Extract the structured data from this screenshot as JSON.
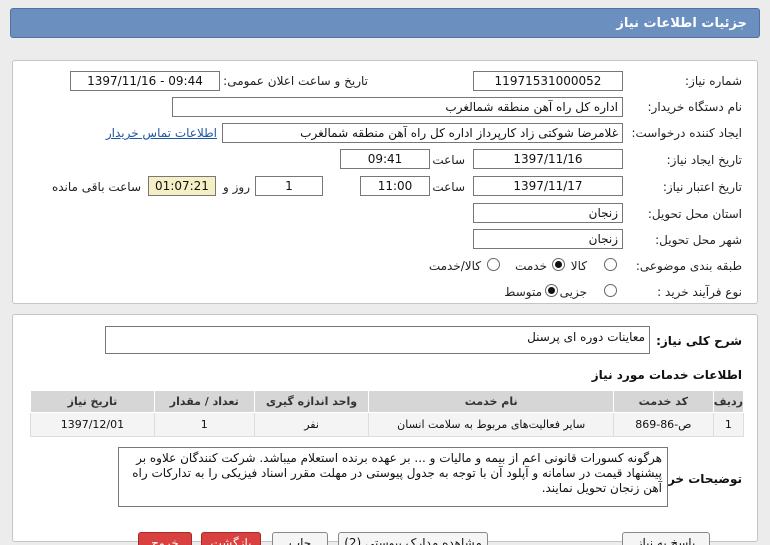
{
  "title": "جزئیات اطلاعات نیاز",
  "form": {
    "need_number_label": "شماره نیاز:",
    "need_number": "11971531000052",
    "announce_label": "تاریخ و ساعت اعلان عمومی:",
    "announce_value": "1397/11/16 - 09:44",
    "buyer_org_label": "نام دستگاه خریدار:",
    "buyer_org": "اداره کل راه آهن منطقه شمالغرب",
    "requester_label": "ایجاد کننده درخواست:",
    "requester": "غلامرضا شوکتی زاد کارپرداز اداره کل راه آهن منطقه شمالغرب",
    "contact_link": "اطلاعات تماس خریدار",
    "create_date_label": "تاریخ ایجاد نیاز:",
    "create_date": "1397/11/16",
    "time_label": "ساعت",
    "create_time": "09:41",
    "validity_label": "تاریخ اعتبار نیاز:",
    "validity_date": "1397/11/17",
    "validity_time": "11:00",
    "days_value": "1",
    "days_label": "روز و",
    "remaining_time": "01:07:21",
    "remaining_label": "ساعت باقی مانده",
    "province_label": "استان محل تحویل:",
    "province": "زنجان",
    "city_label": "شهر محل تحویل:",
    "city": "زنجان",
    "category_label": "طبقه بندی موضوعی:",
    "category_options": [
      "کالا",
      "خدمت",
      "کالا/خدمت"
    ],
    "process_label": "نوع فرآیند خرید :",
    "process_options": [
      "جزیی",
      "متوسط"
    ]
  },
  "summary": {
    "label": "شرح کلی نیاز:",
    "value": "معاینات دوره ای پرسنل"
  },
  "services": {
    "heading": "اطلاعات خدمات مورد نیاز",
    "columns": [
      "ردیف",
      "کد خدمت",
      "نام خدمت",
      "واحد اندازه گیری",
      "تعداد / مقدار",
      "تاریخ نیاز"
    ],
    "rows": [
      [
        "1",
        "ص-86-869",
        "سایر فعالیت‌های مربوط به سلامت انسان",
        "نفر",
        "1",
        "1397/12/01"
      ]
    ]
  },
  "buyer_notes": {
    "label": "توضیحات خریدار:",
    "text": "هرگونه کسورات قانونی اعم از بیمه و مالیات و ... بر عهده برنده استعلام میباشد. شرکت کنندگان علاوه بر پیشنهاد قیمت در سامانه و آپلود آن با توجه به جدول پیوستی در مهلت مقرر اسناد فیزیکی را به تدارکات راه آهن زنجان تحویل نمایند."
  },
  "buttons": {
    "reply": "پاسخ به نیاز",
    "view_docs": "مشاهده مدارک پیوستی (2)",
    "print": "چاپ",
    "back": "بازگشت",
    "exit": "خروج"
  }
}
